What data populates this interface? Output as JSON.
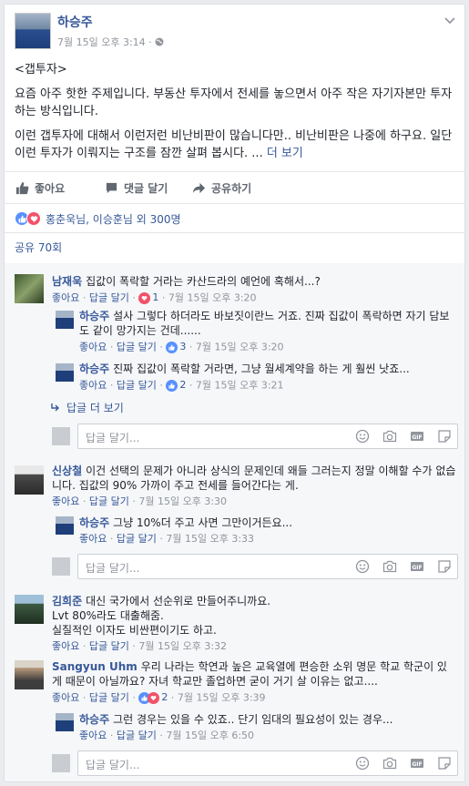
{
  "post": {
    "author": "하승주",
    "meta": "7월 15일 오후 3:14 · ",
    "line1": "<갭투자>",
    "line2": "요즘 아주 핫한 주제입니다. 부동산 투자에서 전세를 놓으면서 아주 작은 자기자본만 투자하는 방식입니다.",
    "line3": "이런 갭투자에 대해서 이런저런 비난비판이 많습니다만.. 비난비판은 나중에 하구요. 일단 이런 투자가 이뤄지는 구조를 잠깐 살펴 봅시다. ... ",
    "more": "더 보기"
  },
  "actions": {
    "like": "좋아요",
    "comment": "댓글 달기",
    "share": "공유하기"
  },
  "reactions": {
    "text": "홍춘욱님, 이승훈님 외 300명"
  },
  "shares": "공유 70회",
  "labels": {
    "like": "좋아요",
    "reply": "답글 달기",
    "sep": " · ",
    "reply_placeholder": "답글 달기...",
    "more_replies": "답글 더 보기"
  },
  "comments": [
    {
      "name": "남재욱",
      "text": "집값이 폭락할 거라는 카산드라의 예언에 혹해서...?",
      "count": "1",
      "time": "7월 15일 오후 3:20",
      "replies": [
        {
          "name": "하승주",
          "text": "설사 그렇다 하더라도 바보짓이란느 거죠. 진짜 집값이 폭락하면 자기 담보도 같이 망가지는 건데......",
          "count": "3",
          "time": "7월 15일 오후 3:20"
        },
        {
          "name": "하승주",
          "text": "진짜 집값이 폭락할 거라면, 그냥 월세계약을 하는 게 훨씬 낫죠...",
          "count": "2",
          "time": "7월 15일 오후 3:21"
        }
      ]
    },
    {
      "name": "신상철",
      "text": "이건 선택의 문제가 아니라 상식의 문제인데 왜들 그러는지 정말 이해할 수가 없습니다. 집값의 90% 가까이 주고 전세를 들어간다는 게.",
      "time": "7월 15일 오후 3:30",
      "replies": [
        {
          "name": "하승주",
          "text": "그냥 10%더 주고 사면 그만이거든요...",
          "time": "7월 15일 오후 3:33"
        }
      ]
    },
    {
      "name": "김희준",
      "text": "대신 국가에서 선순위로 만들어주니까요.",
      "text2": "Lvt 80%라도 대출해줌.",
      "text3": "실질적인 이자도 비싼편이기도 하고.",
      "time": "7월 15일 오후 3:32"
    },
    {
      "name": "Sangyun Uhm",
      "text": "우리 나라는 학연과 높은 교육열에 편승한 소위 명문 학교 학군이 있게 때문이 아닐까요? 자녀 학교만 졸업하면 굳이 거기 살 이유는 없고....",
      "count": "2",
      "time": "7월 15일 오후 3:39",
      "replies": [
        {
          "name": "하승주",
          "text": "그런 경우는 있을 수 있죠.. 단기 임대의 필요성이 있는 경우...",
          "time": "7월 15일 오후 6:50"
        }
      ]
    }
  ],
  "colors": {
    "link": "#365899",
    "like_blue": "#5890ff",
    "love_red": "#f25268",
    "muted": "#90949c"
  }
}
